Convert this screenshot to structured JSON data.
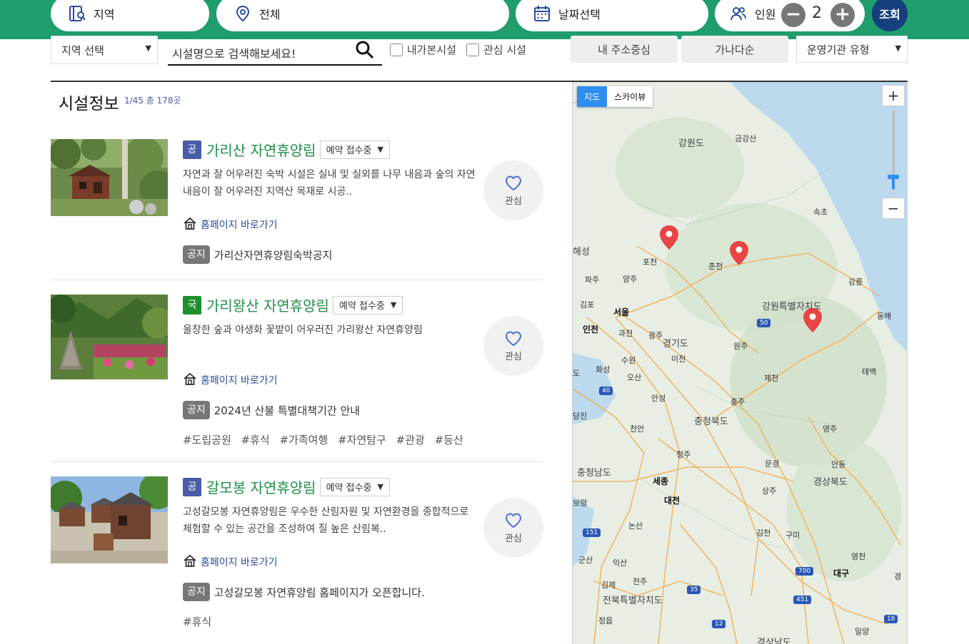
{
  "topbar": {
    "region_label": "지역",
    "type_label": "전체",
    "date_label": "날짜선택",
    "people_label": "인원",
    "people_count": "2",
    "minus": "−",
    "plus": "+",
    "search_button": "조회"
  },
  "filters": {
    "region_select": "지역 선택",
    "search_placeholder": "시설명으로 검색해보세요!",
    "visited_label": "내가본시설",
    "favorite_label": "관심 시설",
    "sort_address": "내 주소중심",
    "sort_alpha": "가나다순",
    "org_select": "운영기관 유형"
  },
  "list": {
    "title": "시설정보",
    "count": "1/45 총 178곳",
    "favorite_label": "관심",
    "homepage_label": "홈페이지 바로가기",
    "notice_tag": "공지",
    "items": [
      {
        "badge": "공",
        "name": "가리산 자연휴양림",
        "status": "예약 접수중",
        "desc": " 자연과 잘 어우러진 숙박 시설은 실내 및 실외를 나무 내음과 숲의 자연 내음이 잘 어우러진 지역산 목재로 시공..",
        "notice": "가리산자연휴양림숙박공지",
        "tags": []
      },
      {
        "badge": "국",
        "name": "가리왕산 자연휴양림",
        "status": "예약 접수중",
        "desc": "울창한 숲과 야생화 꽃밭이 어우러진 가리왕산 자연휴양림",
        "notice": "2024년 산불 특별대책기간 안내",
        "tags": [
          "#도립공원",
          "#휴식",
          "#가족여행",
          "#자연탐구",
          "#관광",
          "#등산"
        ]
      },
      {
        "badge": "공",
        "name": "갈모봉 자연휴양림",
        "status": "예약 접수중",
        "desc": "고성갈모봉 자연휴양림은 우수한 산림자원 및 자연환경을 종합적으로 체험할 수 있는 공간을 조성하여 질 높은 산림복..",
        "notice": "고성갈모봉 자연휴양림 홈페이지가 오픈합니다.",
        "tags": [
          "#휴식"
        ]
      }
    ]
  },
  "map": {
    "type_map": "지도",
    "type_sky": "스카이뷰",
    "zoom_in": "+",
    "zoom_out": "−",
    "labels": {
      "gangwon_do": "강원도",
      "geumgang": "금강산",
      "sokcho": "속초",
      "haeseong": "해성",
      "pocheon": "포천",
      "chuncheon": "춘천",
      "paju": "파주",
      "yangju": "양주",
      "gangneung": "강릉",
      "gimpo": "김포",
      "seoul": "서울",
      "gangwon_state": "강원특별자치도",
      "donghae": "동해",
      "incheon": "인천",
      "gwacheon": "과천",
      "gwangju_g": "광주",
      "gyeonggi": "경기도",
      "wonju": "원주",
      "suwon": "수원",
      "icheon": "이천",
      "hwaseong": "화성",
      "osan": "오산",
      "jecheon": "제천",
      "taebaek": "태백",
      "anseong": "안성",
      "chungju": "충주",
      "dangjin": "당진",
      "cheonan": "천안",
      "chungbuk": "충청북도",
      "yeongju": "영주",
      "cheongju": "청주",
      "mungyeong": "문경",
      "andong": "안동",
      "chungnam": "충청남도",
      "sejong": "세종",
      "sangju": "상주",
      "gyeongbuk": "경상북도",
      "boryeong": "보령",
      "daejeon": "대전",
      "nonsan": "논산",
      "gimcheon": "김천",
      "gumi": "구미",
      "gunsan": "군산",
      "iksan": "익산",
      "yeongcheon": "영천",
      "daegu": "대구",
      "gimje": "김제",
      "jeonju": "전주",
      "jeonbuk": "전북특별자치도",
      "jeongeup": "정읍",
      "miryang": "밀양",
      "gyeongnam": "경상남도",
      "do": "도",
      "gyeong": "경",
      "r50": "50",
      "r40": "40",
      "r151": "151",
      "r700": "700",
      "r35": "35",
      "r451": "451",
      "r12": "12",
      "r16": "16"
    }
  },
  "colors": {
    "brand_green": "#1f9d6c",
    "navy": "#163f7d",
    "title_green": "#1e8f4a",
    "badge_public": "#4a5ba8",
    "badge_national": "#1e8f2e",
    "pin_red": "#e84545",
    "map_blue": "#2e8ef2"
  }
}
